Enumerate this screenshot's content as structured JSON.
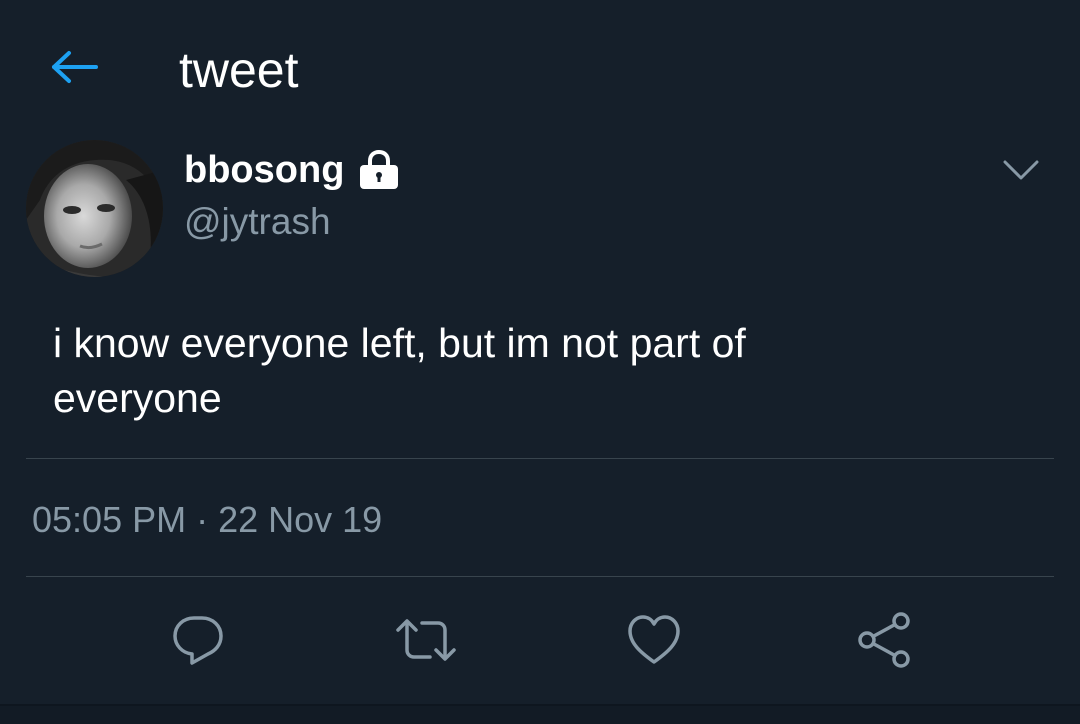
{
  "header": {
    "title": "tweet",
    "back_icon": "back-arrow-icon"
  },
  "author": {
    "display_name": "bbosong",
    "handle": "@jytrash",
    "protected_icon": "lock-icon"
  },
  "tweet": {
    "text_line_1": "i know everyone left, but im not part of",
    "text_line_2": "everyone",
    "time": "05:05 PM",
    "separator": "·",
    "date": "22 Nov 19"
  },
  "actions": {
    "icons": [
      "reply-icon",
      "retweet-icon",
      "like-icon",
      "share-icon"
    ]
  },
  "colors": {
    "background": "#151f2a",
    "accent": "#1da1f2",
    "secondary_text": "#8899a6",
    "divider": "#38444d"
  }
}
